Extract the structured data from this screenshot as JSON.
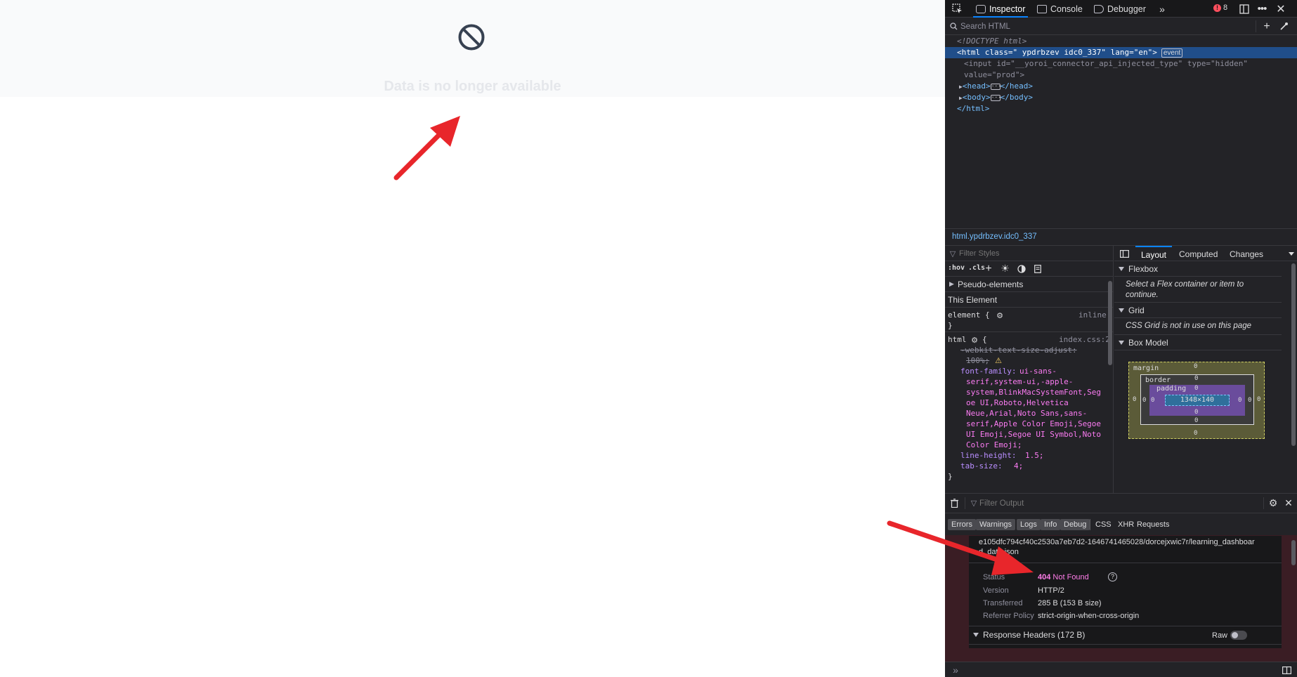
{
  "viewport": {
    "empty_state_message": "Data is no longer available",
    "icon": "prohibited-icon"
  },
  "devtools": {
    "tabs": {
      "inspector": "Inspector",
      "console": "Console",
      "debugger": "Debugger"
    },
    "error_count": "8",
    "search_placeholder": "Search HTML",
    "markup": {
      "doctype": "<!DOCTYPE html>",
      "html_open_tag": "html",
      "html_class_attr": "class",
      "html_class_val": "\" ypdrbzev idc0_337\"",
      "html_lang_attr": "lang",
      "html_lang_val": "\"en\"",
      "event_badge": "event",
      "input_tag": "input",
      "input_id_attr": "id",
      "input_id_val": "\"__yoroi_connector_api_injected_type\"",
      "input_type_attr": "type",
      "input_type_val": "\"hidden\"",
      "input_value_attr": "value",
      "input_value_val": "\"prod\"",
      "head_tag": "head",
      "body_tag": "body",
      "html_close": "html"
    },
    "breadcrumb": "html.ypdrbzev.idc0_337",
    "styles": {
      "filter_placeholder": "Filter Styles",
      "hov": ":hov",
      "cls": ".cls",
      "pseudo_elements": "Pseudo-elements",
      "this_element": "This Element",
      "element_rule": "element {",
      "inline": "inline",
      "close_brace": "}",
      "html_rule": "html",
      "html_source": "index.css:2",
      "webkit_prop": "-webkit-text-size-adjust:",
      "webkit_val": "100%;",
      "font_family_prop": "font-family:",
      "font_family_lines": [
        "ui-sans-",
        "serif,system-ui,-apple-",
        "system,BlinkMacSystemFont,Seg",
        "oe UI,Roboto,Helvetica",
        "Neue,Arial,Noto Sans,sans-",
        "serif,Apple Color Emoji,Segoe",
        "UI Emoji,Segoe UI Symbol,Noto",
        "Color Emoji;"
      ],
      "line_height_prop": "line-height:",
      "line_height_val": "1.5;",
      "tab_size_prop": "tab-size:",
      "tab_size_val": "4;"
    },
    "layout": {
      "tabs": {
        "layout": "Layout",
        "computed": "Computed",
        "changes": "Changes"
      },
      "flexbox": "Flexbox",
      "flexbox_note": "Select a Flex container or item to continue.",
      "grid": "Grid",
      "grid_note": "CSS Grid is not in use on this page",
      "box_model": "Box Model",
      "box_labels": {
        "margin": "margin",
        "border": "border",
        "padding": "padding"
      },
      "content_size": "1348×140",
      "zero": "0"
    },
    "console": {
      "filter_placeholder": "Filter Output",
      "filters": [
        "Errors",
        "Warnings",
        "Logs",
        "Info",
        "Debug"
      ],
      "types": [
        "CSS",
        "XHR",
        "Requests"
      ],
      "request_url": [
        "e105dfc794cf40c2530a7eb7d2-1646741465028/dorcejxwic7r/learning_dashboar",
        "d_data.json"
      ],
      "rows": [
        {
          "label": "Status",
          "value_code": "404",
          "value_text": "Not Found"
        },
        {
          "label": "Version",
          "value": "HTTP/2"
        },
        {
          "label": "Transferred",
          "value": "285 B (153 B size)"
        },
        {
          "label": "Referrer Policy",
          "value": "strict-origin-when-cross-origin"
        }
      ],
      "response_headers": "Response Headers (172 B)",
      "raw": "Raw"
    }
  }
}
